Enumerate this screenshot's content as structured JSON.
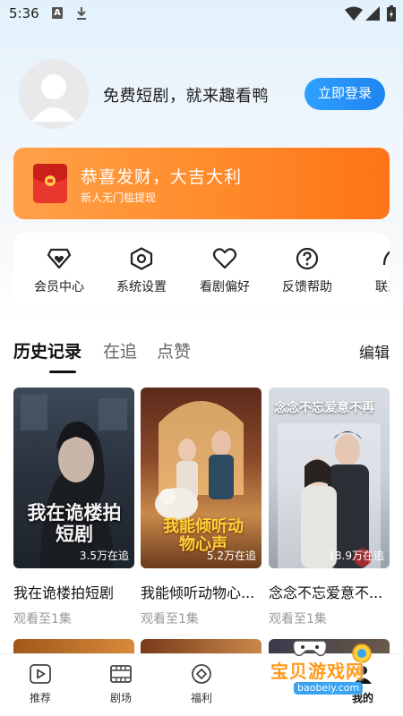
{
  "status_bar": {
    "time": "5:36",
    "notif_letter": "A"
  },
  "profile": {
    "prompt": "免费短剧，就来趣看鸭",
    "login_button": "立即登录"
  },
  "promo": {
    "title": "恭喜发财，大吉大利",
    "subtitle": "新人无门槛提现"
  },
  "quick_menu": [
    {
      "label": "会员中心",
      "icon": "vip-heart-icon"
    },
    {
      "label": "系统设置",
      "icon": "settings-hex-icon"
    },
    {
      "label": "看剧偏好",
      "icon": "heart-icon"
    },
    {
      "label": "反馈帮助",
      "icon": "help-circle-icon"
    },
    {
      "label": "联系",
      "icon": "contact-icon"
    }
  ],
  "tabs": [
    {
      "label": "历史记录",
      "active": true
    },
    {
      "label": "在追",
      "active": false
    },
    {
      "label": "点赞",
      "active": false
    }
  ],
  "edit_label": "编辑",
  "history": [
    {
      "title": "我在诡楼拍短剧",
      "views": "3.5万在追",
      "progress": "观看至1集",
      "poster_text": "我在诡楼拍短剧"
    },
    {
      "title": "我能倾听动物心声",
      "title_display": "我能倾听动物心...",
      "views": "5.2万在追",
      "progress": "观看至1集",
      "poster_text": "我能倾听动物心声"
    },
    {
      "title": "念念不忘爱意不再",
      "title_display": "念念不忘爱意不...",
      "views": "18.9万在追",
      "progress": "观看至1集",
      "poster_text": "念念不忘爱意不再"
    }
  ],
  "bottom_nav": [
    {
      "label": "推荐",
      "icon": "play-square-icon"
    },
    {
      "label": "剧场",
      "icon": "film-icon"
    },
    {
      "label": "福利",
      "icon": "diamond-circle-icon"
    },
    {
      "label": "我的",
      "icon": "user-icon",
      "active": true
    }
  ],
  "watermark": {
    "text": "宝贝游戏网",
    "url": "baobeiy.com"
  },
  "colors": {
    "login_button": "#1f84f0",
    "promo": "#ff8a2a",
    "active_text": "#111111"
  }
}
